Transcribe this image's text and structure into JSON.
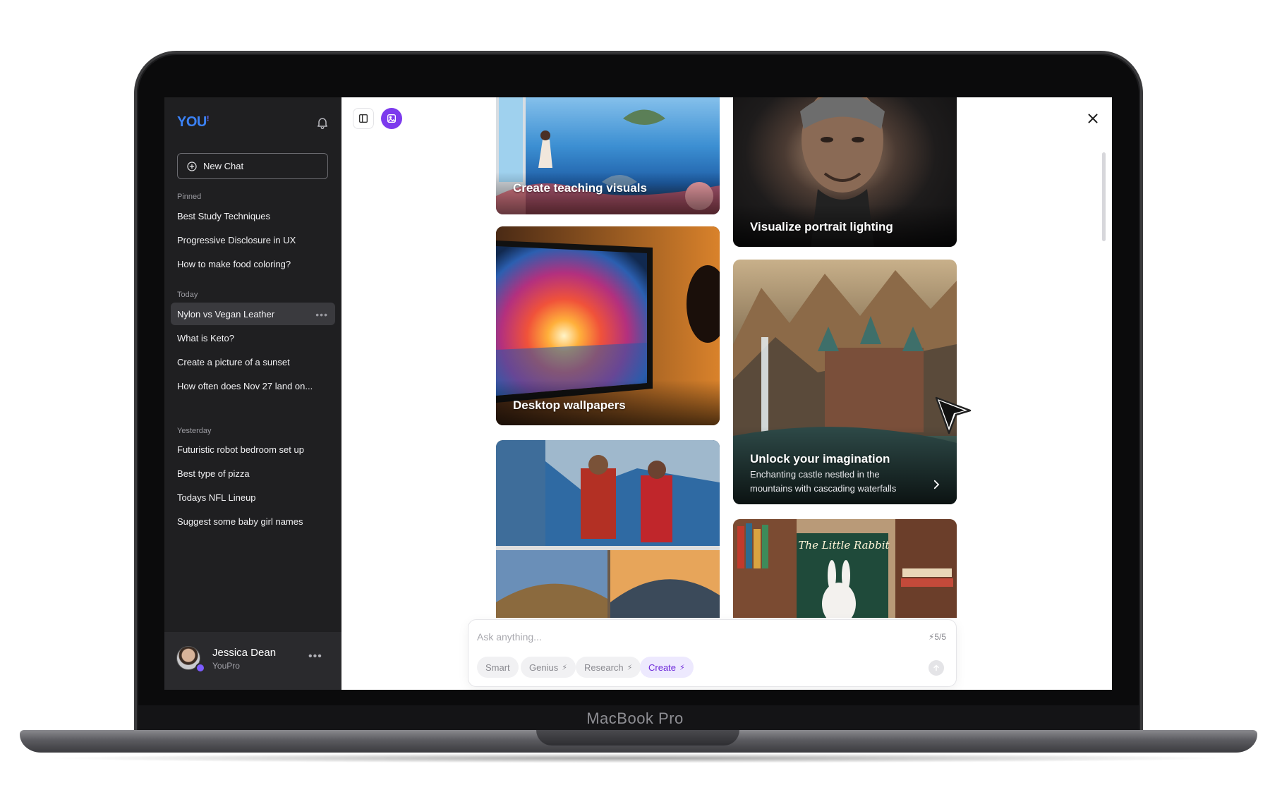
{
  "device": {
    "label": "MacBook Pro"
  },
  "sidebar": {
    "logo": "YOU",
    "new_chat_label": "New Chat",
    "sections": {
      "pinned": "Pinned",
      "today": "Today",
      "yesterday": "Yesterday"
    },
    "pinned_items": [
      "Best Study Techniques",
      "Progressive Disclosure in UX",
      "How to make food coloring?"
    ],
    "today_items": [
      "Nylon vs Vegan Leather",
      "What is Keto?",
      "Create a picture of a sunset",
      "How often does Nov 27 land on..."
    ],
    "yesterday_items": [
      "Futuristic robot bedroom set up",
      "Best type of pizza",
      "Todays NFL Lineup",
      "Suggest some baby girl names"
    ],
    "active_item_more": "•••",
    "user": {
      "name": "Jessica Dean",
      "plan": "YouPro",
      "more": "•••"
    }
  },
  "cards": {
    "teaching": {
      "title": "Create teaching visuals"
    },
    "portrait": {
      "title": "Visualize portrait lighting"
    },
    "wallpapers": {
      "title": "Desktop wallpapers"
    },
    "imagination": {
      "title": "Unlock your imagination",
      "subtitle": "Enchanting castle nestled in the mountains with cascading waterfalls"
    },
    "book_cover_text": "The Little Rabbit"
  },
  "composer": {
    "placeholder": "Ask anything...",
    "credits": "5/5",
    "modes": [
      "Smart",
      "Genius",
      "Research",
      "Create"
    ]
  },
  "colors": {
    "accent": "#7c3aed",
    "logo": "#3b82f6",
    "sidebar_bg": "#1f1f21"
  }
}
